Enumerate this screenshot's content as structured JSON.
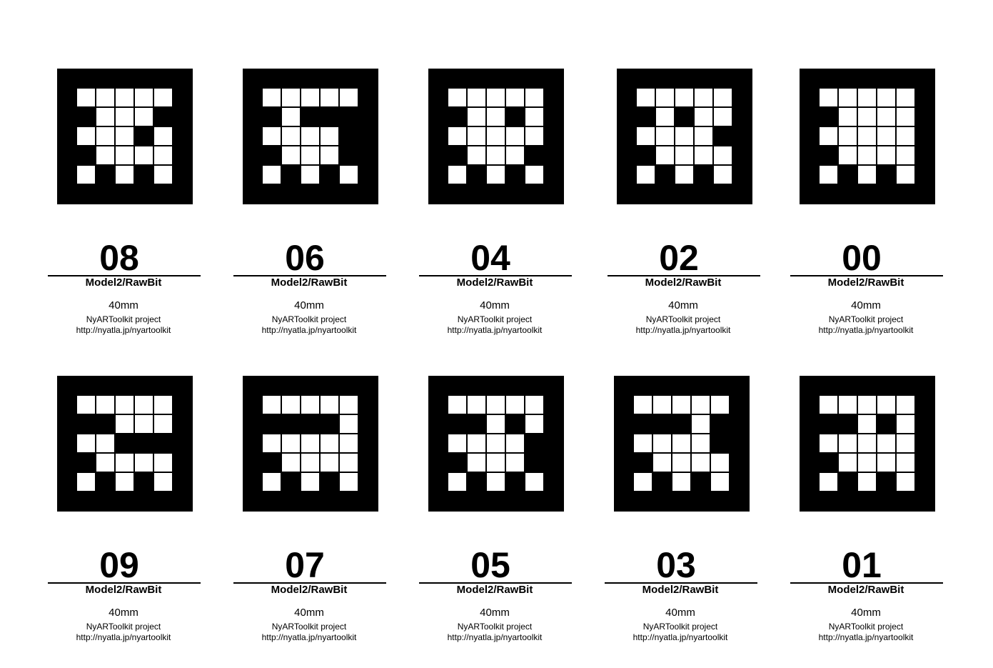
{
  "common": {
    "model_label": "Model2/RawBit",
    "size_label": "40mm",
    "project_label": "NyARToolkit project",
    "url_label": "http://nyatla.jp/nyartoolkit"
  },
  "markers": [
    {
      "id": "08",
      "pattern": [
        "WWWWW",
        "BWWWB",
        "WWWBW",
        "BWWWW",
        "WBWBW"
      ]
    },
    {
      "id": "06",
      "pattern": [
        "WWWWW",
        "BWBBB",
        "WWWWB",
        "BWWWB",
        "WBWBW"
      ]
    },
    {
      "id": "04",
      "pattern": [
        "WWWWW",
        "BWWBW",
        "WWWWW",
        "BWWWB",
        "WBWBW"
      ]
    },
    {
      "id": "02",
      "pattern": [
        "WWWWW",
        "BWBWW",
        "WWWWB",
        "BWWWW",
        "WBWBW"
      ]
    },
    {
      "id": "00",
      "pattern": [
        "WWWWW",
        "BWWWW",
        "WWWWW",
        "BWWWW",
        "WBWBW"
      ]
    },
    {
      "id": "09",
      "pattern": [
        "WWWWW",
        "BBWWW",
        "WWBBB",
        "BWWWW",
        "WBWBW"
      ]
    },
    {
      "id": "07",
      "pattern": [
        "WWWWW",
        "BBBBW",
        "WWWWW",
        "BWWWW",
        "WBWBW"
      ]
    },
    {
      "id": "05",
      "pattern": [
        "WWWWW",
        "BBWBW",
        "WWWWB",
        "BWWWB",
        "WBWBW"
      ]
    },
    {
      "id": "03",
      "pattern": [
        "WWWWW",
        "BBBWB",
        "WWWWB",
        "BWWWW",
        "WBWBW"
      ]
    },
    {
      "id": "01",
      "pattern": [
        "WWWWW",
        "BBWBW",
        "WWWWW",
        "BWWWW",
        "WBWBW"
      ]
    }
  ]
}
